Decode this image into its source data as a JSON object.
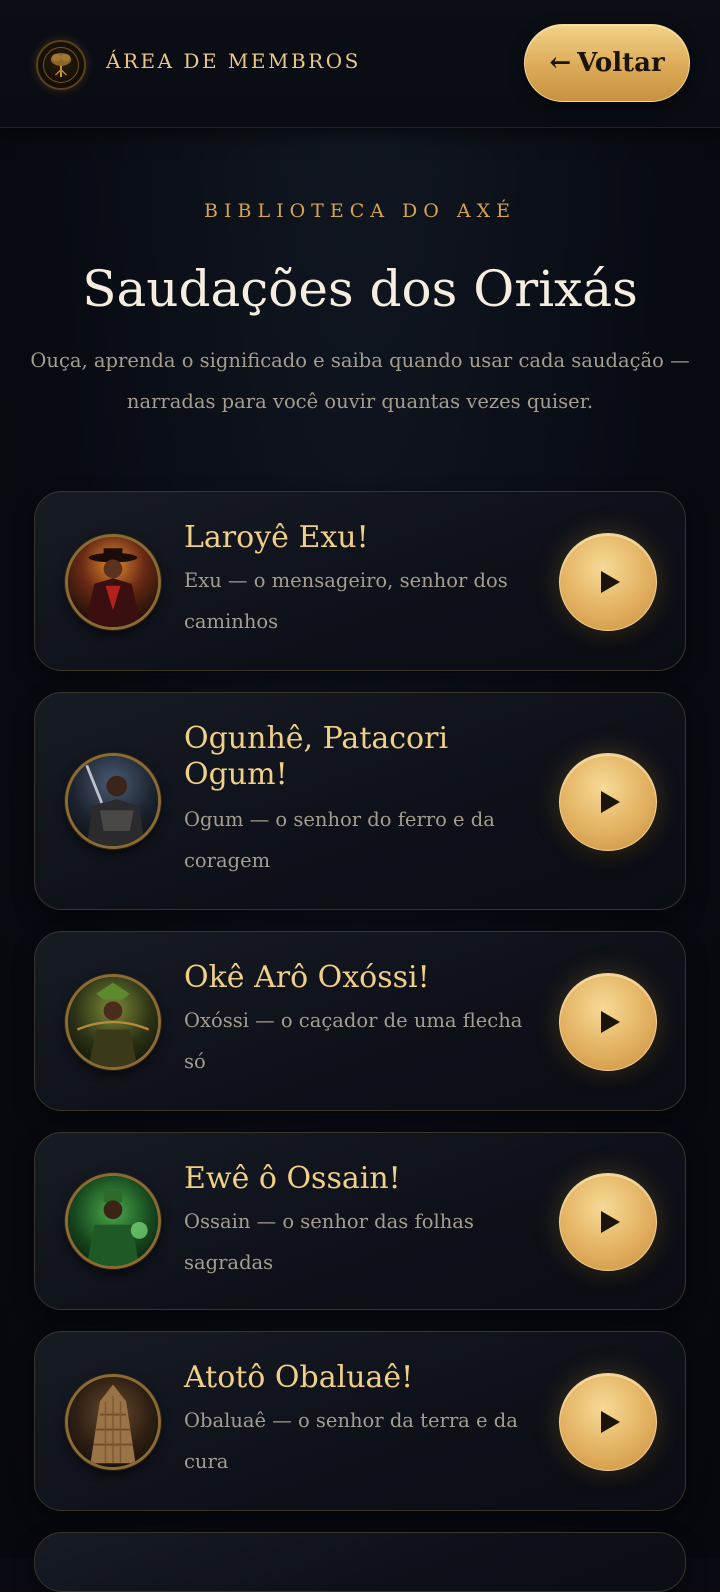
{
  "header": {
    "brand": "ÁREA DE MEMBROS",
    "back_arrow": "←",
    "back_label": "Voltar"
  },
  "intro": {
    "eyebrow": "BIBLIOTECA DO AXÉ",
    "title": "Saudações dos Orixás",
    "subtitle": "Ouça, aprenda o significado e saiba quando usar cada saudação — narradas para você ouvir quantas vezes quiser."
  },
  "greetings": [
    {
      "title": "Laroyê Exu!",
      "description": "Exu — o mensageiro, senhor dos caminhos"
    },
    {
      "title": "Ogunhê, Patacori Ogum!",
      "description": "Ogum — o senhor do ferro e da coragem"
    },
    {
      "title": "Okê Arô Oxóssi!",
      "description": "Oxóssi — o caçador de uma flecha só"
    },
    {
      "title": "Ewê ô Ossain!",
      "description": "Ossain — o senhor das folhas sagradas"
    },
    {
      "title": "Atotô Obaluaê!",
      "description": "Obaluaê — o senhor da terra e da cura"
    }
  ],
  "icons": {
    "play": "play-icon",
    "back": "arrow-left-icon",
    "logo": "tree-logo-icon"
  },
  "colors": {
    "background": "#080b12",
    "accent_gold": "#e4b464",
    "title_gold": "#f0cf86",
    "muted_text": "#a49d90"
  }
}
